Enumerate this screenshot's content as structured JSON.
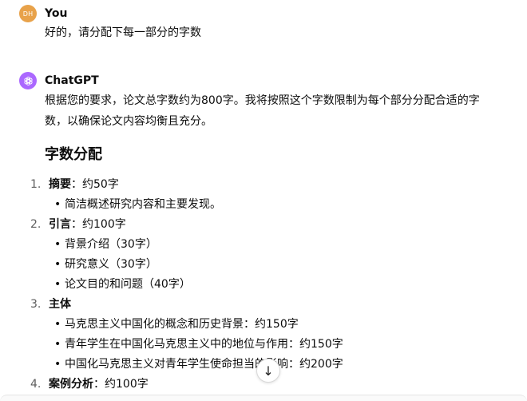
{
  "user_message": {
    "avatar_initials": "DH",
    "author": "You",
    "text": "好的，请分配下每一部分的字数"
  },
  "assistant_message": {
    "avatar_icon": "openai-logo-icon",
    "author": "ChatGPT",
    "intro": "根据您的要求，论文总字数约为800字。我将按照这个字数限制为每个部分分配合适的字数，以确保论文内容均衡且充分。",
    "section_title": "字数分配",
    "items": [
      {
        "num": "1.",
        "title": "摘要",
        "rest": "：约50字",
        "sub": [
          "简洁概述研究内容和主要发现。"
        ]
      },
      {
        "num": "2.",
        "title": "引言",
        "rest": "：约100字",
        "sub": [
          "背景介绍（30字）",
          "研究意义（30字）",
          "论文目的和问题（40字）"
        ]
      },
      {
        "num": "3.",
        "title": "主体",
        "rest": "",
        "sub": [
          "马克思主义中国化的概念和历史背景：约150字",
          "青年学生在中国化马克思主义中的地位与作用：约150字",
          "中国化马克思主义对青年学生使命担当的影响：约200字"
        ]
      },
      {
        "num": "4.",
        "title": "案例分析",
        "rest": "：约100字",
        "sub": []
      }
    ]
  },
  "scroll_down_button": {
    "icon": "arrow-down-icon",
    "glyph": "↓"
  },
  "colors": {
    "user_avatar": "#e8a24a",
    "assistant_avatar": "#ab68ff",
    "text": "#0d0d0d",
    "list_number": "#5d5d5d"
  }
}
